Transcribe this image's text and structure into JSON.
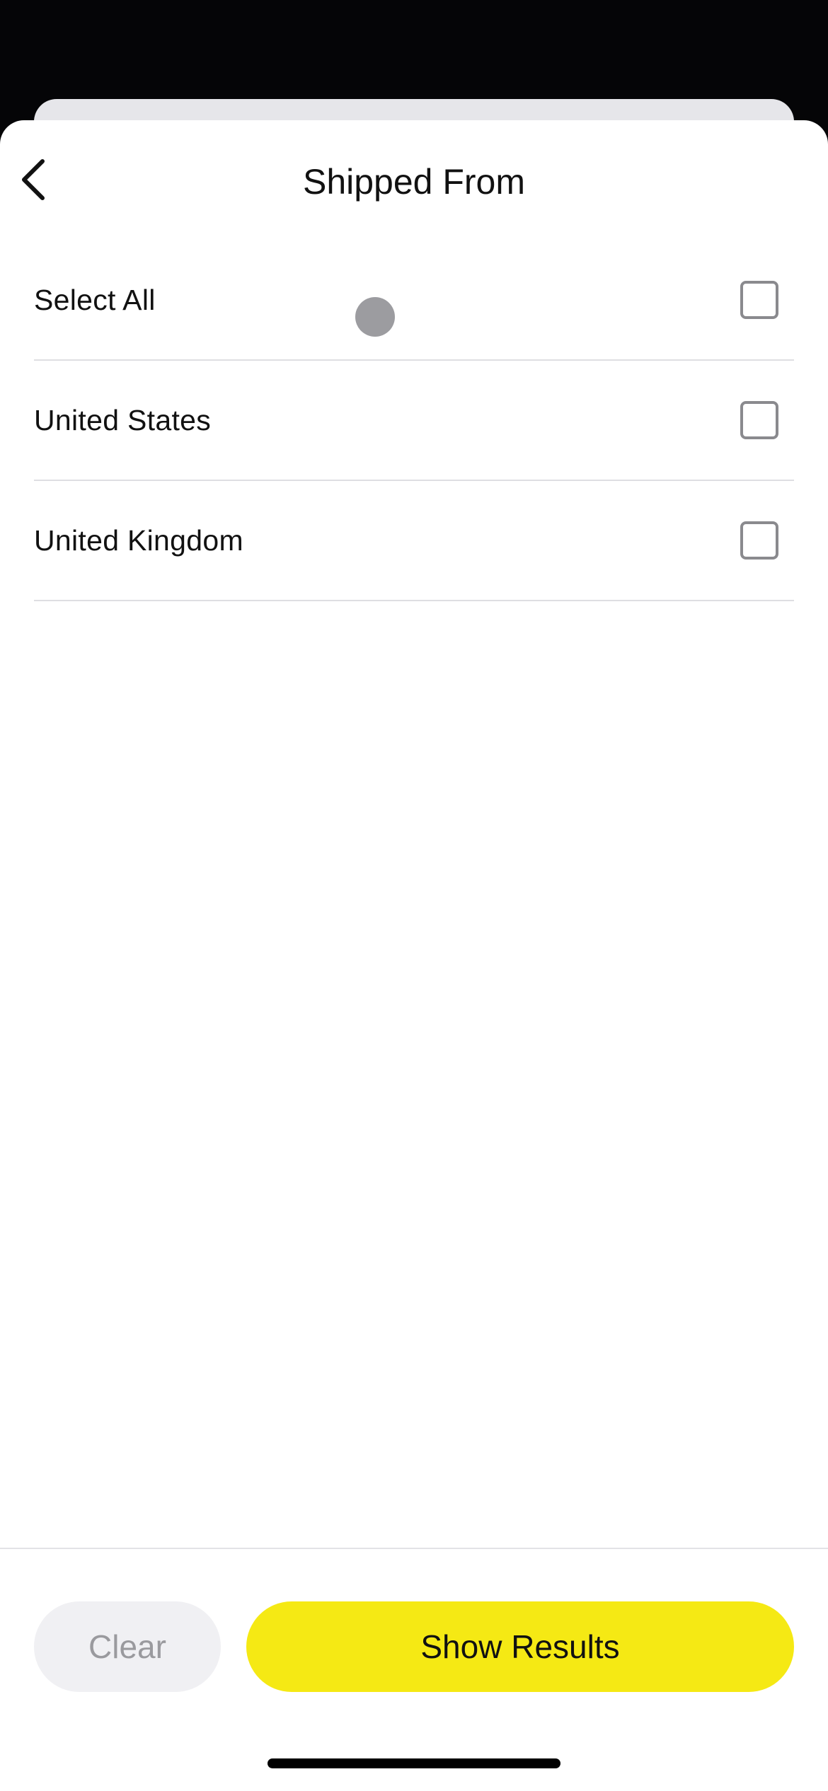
{
  "header": {
    "title": "Shipped From",
    "back_icon": "chevron-left-icon"
  },
  "options": [
    {
      "label": "Select All",
      "checked": false
    },
    {
      "label": "United States",
      "checked": false
    },
    {
      "label": "United Kingdom",
      "checked": false
    }
  ],
  "footer": {
    "clear_label": "Clear",
    "show_results_label": "Show Results"
  },
  "colors": {
    "accent": "#f5e914",
    "checkbox_border": "#8a8a8e",
    "clear_bg": "#f0f0f3",
    "clear_text": "#9a9a9e"
  }
}
